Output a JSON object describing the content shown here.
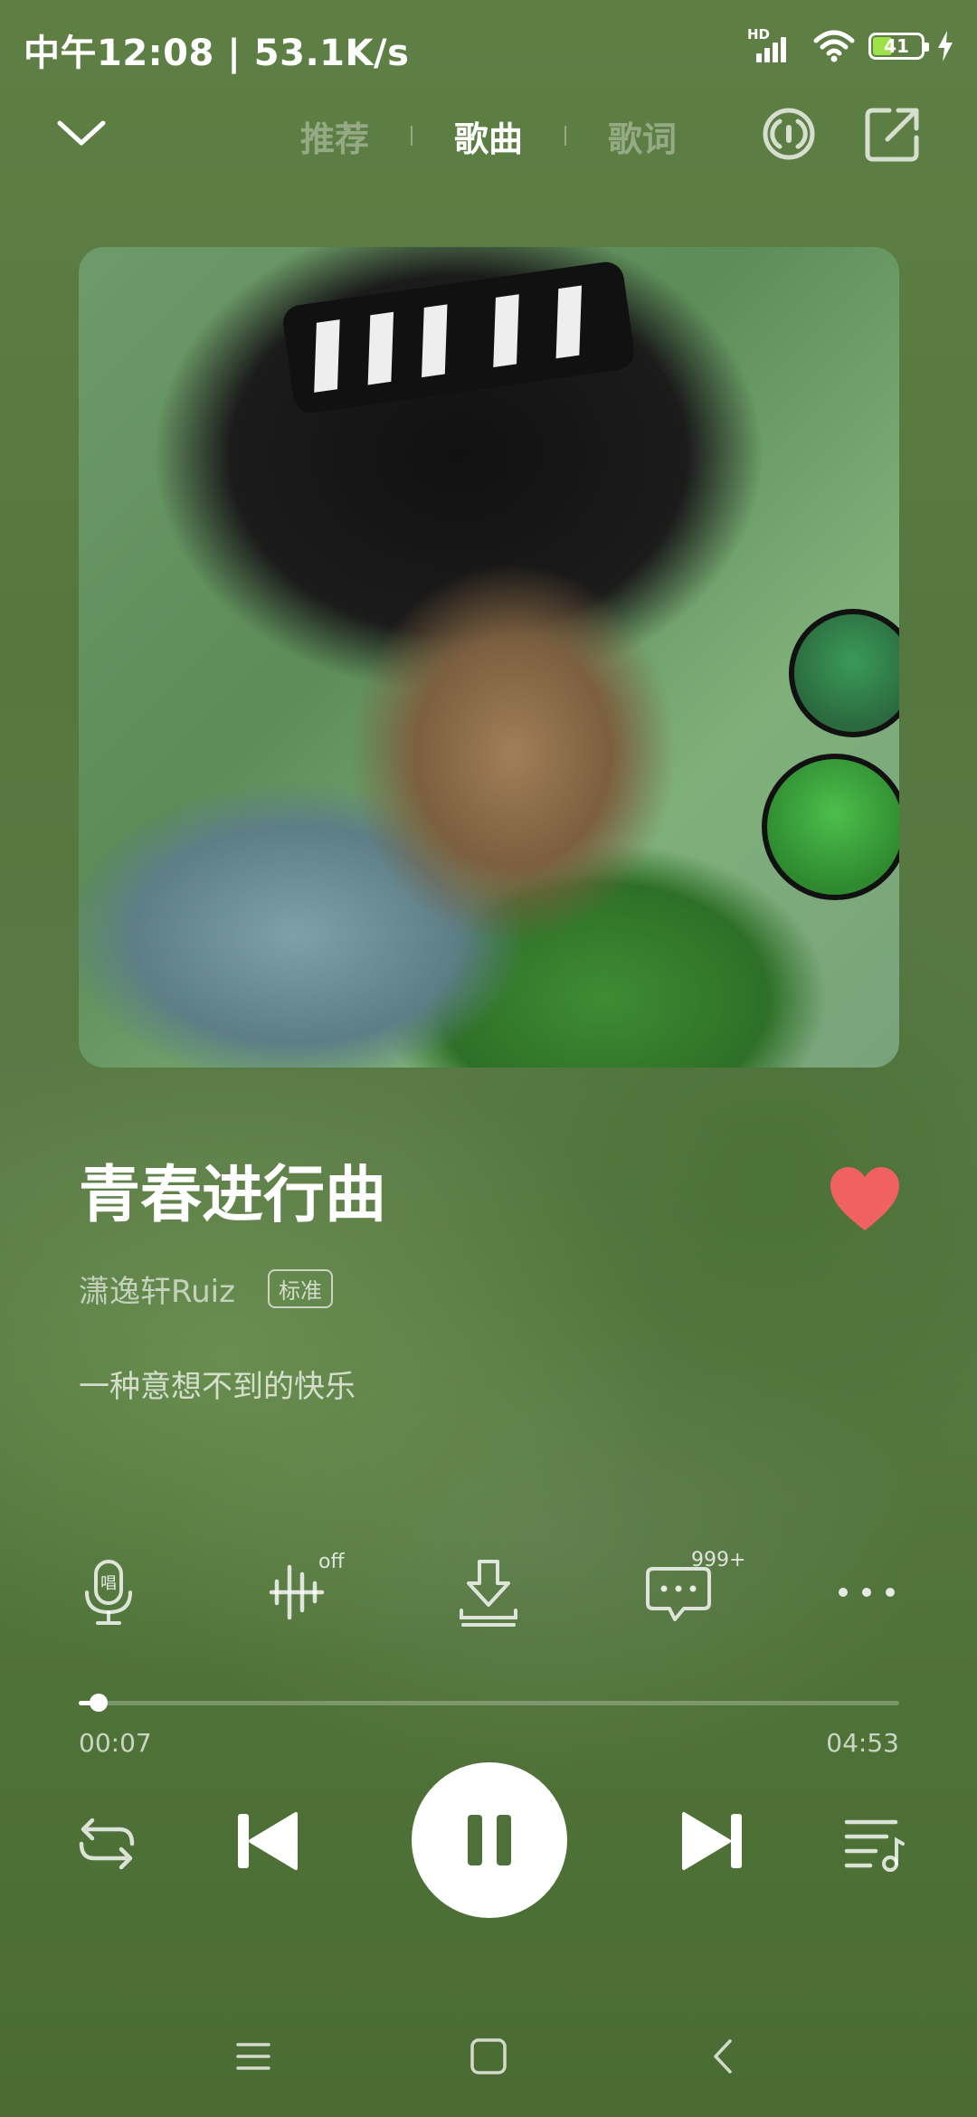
{
  "status_bar": {
    "time_speed": "中午12:08 | 53.1K/s",
    "network_badge": "HD",
    "battery_level": "41",
    "battery_color": "#9ee24a"
  },
  "header": {
    "tabs": [
      {
        "label": "推荐",
        "active": false
      },
      {
        "label": "歌曲",
        "active": true
      },
      {
        "label": "歌词",
        "active": false
      }
    ],
    "icons": [
      "chevron-down-icon",
      "radio-icon",
      "share-icon"
    ]
  },
  "song": {
    "title": "青春进行曲",
    "artist": "潇逸轩Ruiz",
    "quality": "标准",
    "subtitle": "一种意想不到的快乐",
    "liked": true,
    "like_color": "#f06262"
  },
  "actions": {
    "karaoke_icon_char": "唱",
    "sound_effect_badge": "off",
    "comment_count": "999+"
  },
  "playback": {
    "current_time": "00:07",
    "total_time": "04:53",
    "progress_fraction": 0.024,
    "state": "playing"
  },
  "accent": "#ffffff"
}
